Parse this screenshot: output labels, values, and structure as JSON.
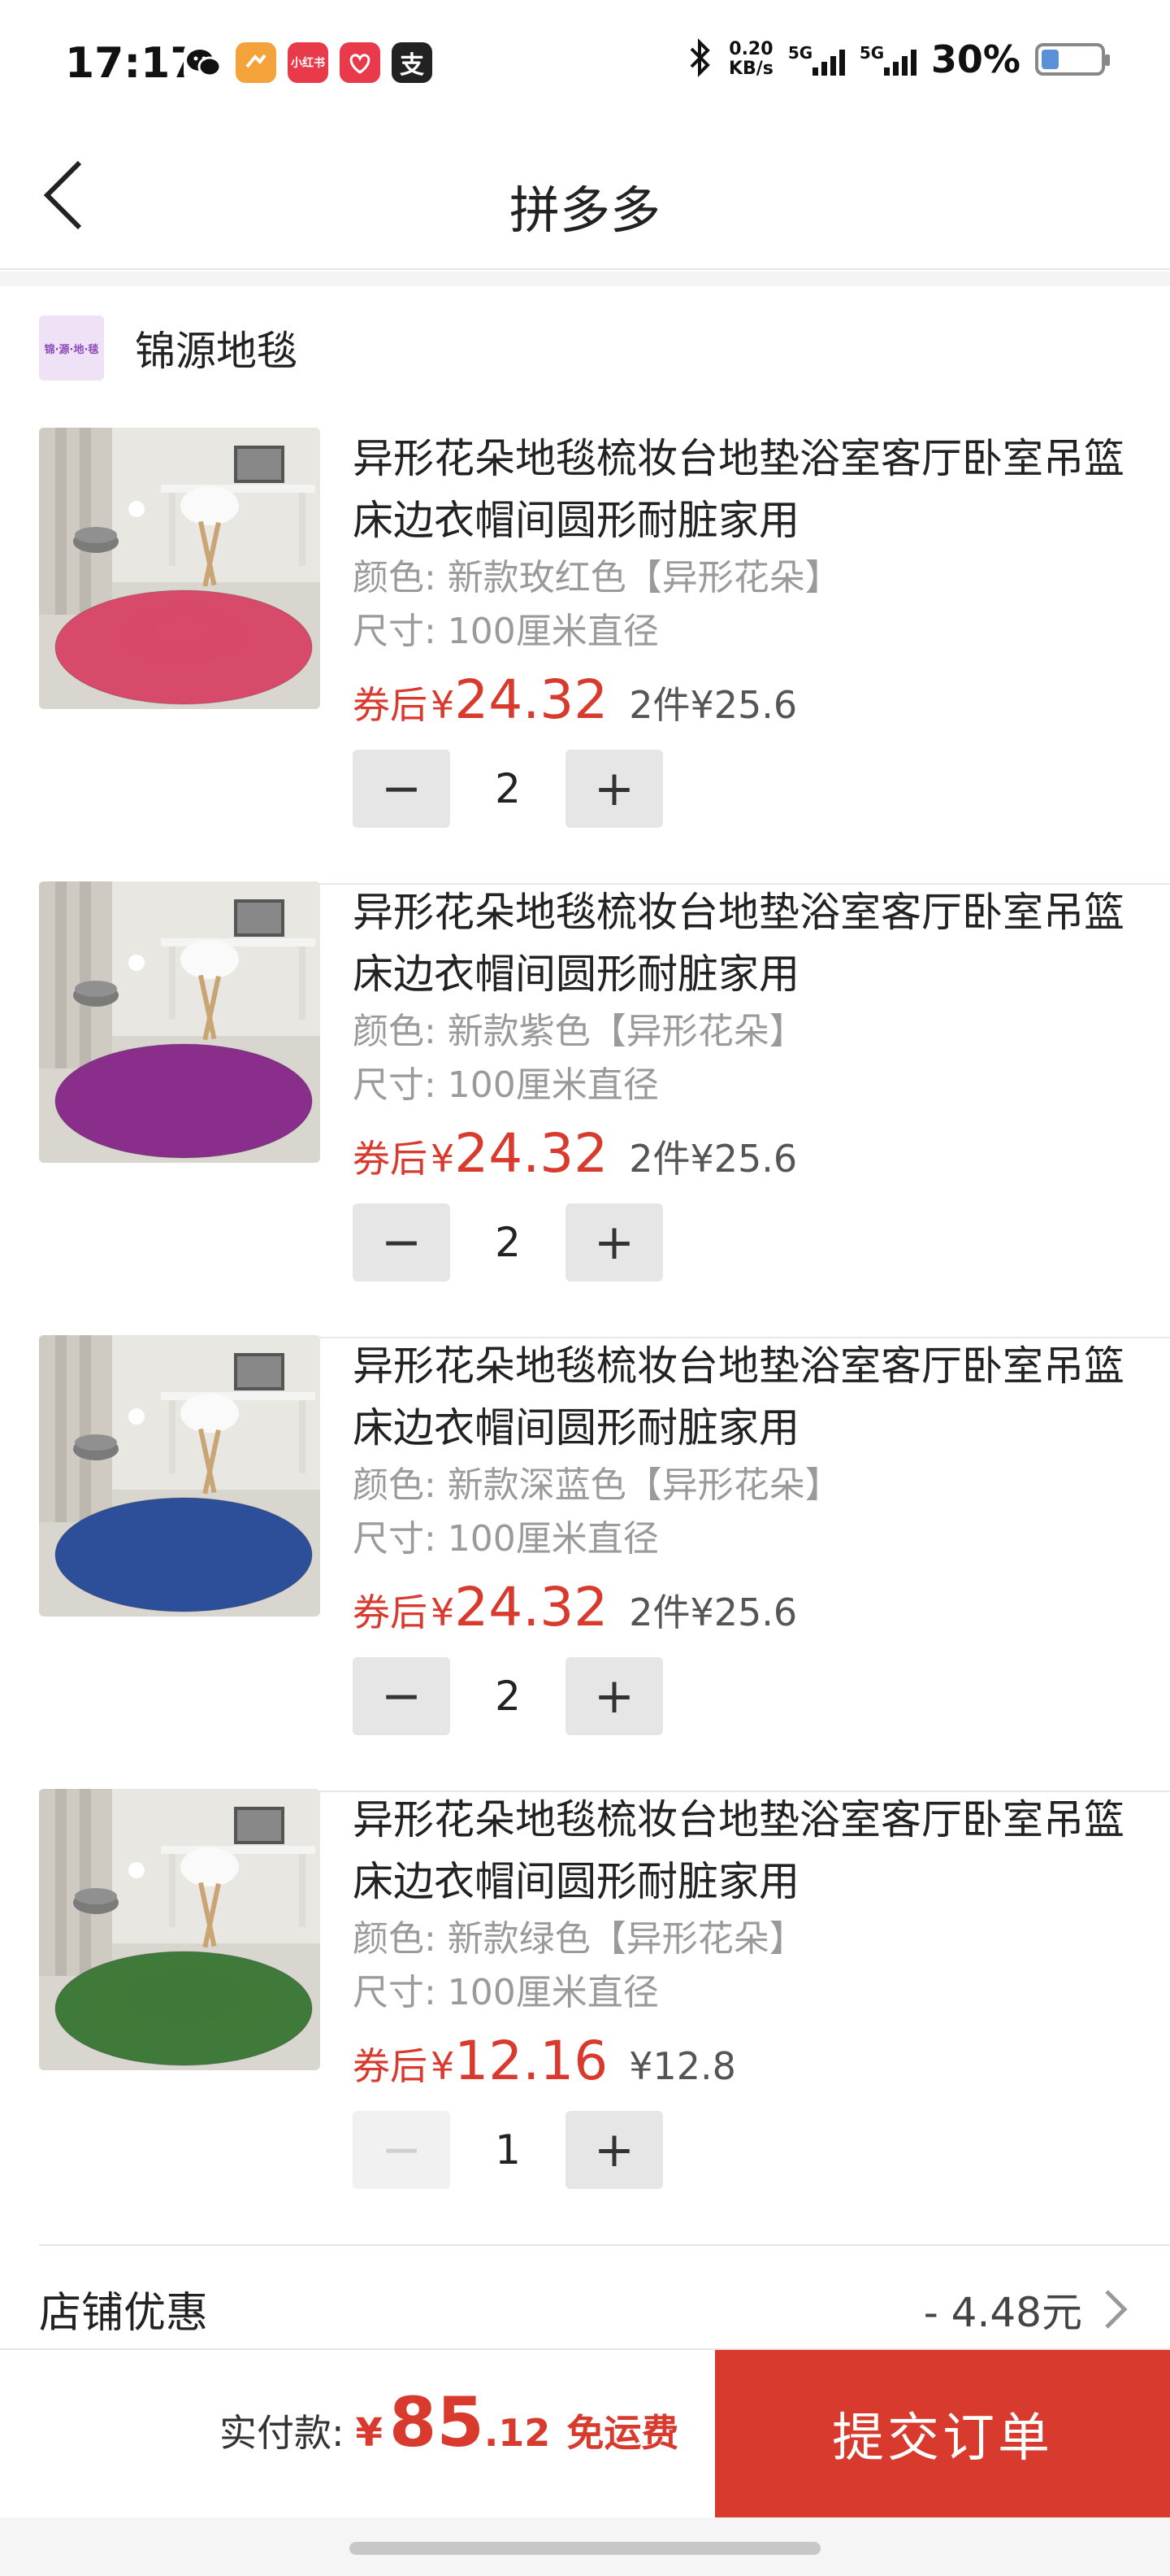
{
  "status_bar": {
    "time": "17:17",
    "apps": [
      {
        "icon": "wechat-icon",
        "label": "",
        "color": "#111111"
      },
      {
        "icon": "orange-app-icon",
        "label": "",
        "color": "#f3a33a"
      },
      {
        "icon": "xiaohongshu-icon",
        "label": "小红书",
        "color": "#e83a4a"
      },
      {
        "icon": "heart-app-icon",
        "label": "",
        "color": "#e83a4a"
      },
      {
        "icon": "alipay-icon",
        "label": "支",
        "color": "#222222"
      }
    ],
    "net_speed_value": "0.20",
    "net_speed_unit": "KB/s",
    "signal_label": "5G",
    "battery_pct": "30%",
    "battery_level": 0.3
  },
  "header": {
    "title": "拼多多"
  },
  "shop": {
    "logo_text": "锦·源·地·毯",
    "name": "锦源地毯"
  },
  "items": [
    {
      "title": "异形花朵地毯梳妆台地垫浴室客厅卧室吊篮床边衣帽间圆形耐脏家用",
      "color": "颜色: 新款玫红色【异形花朵】",
      "size": "尺寸: 100厘米直径",
      "coupon_label": "券后",
      "currency": "¥",
      "price": "24.32",
      "orig": "2件¥25.6",
      "minus": "−",
      "plus": "+",
      "qty": "2",
      "rose_color": "#d84a6a"
    },
    {
      "title": "异形花朵地毯梳妆台地垫浴室客厅卧室吊篮床边衣帽间圆形耐脏家用",
      "color": "颜色: 新款紫色【异形花朵】",
      "size": "尺寸: 100厘米直径",
      "coupon_label": "券后",
      "currency": "¥",
      "price": "24.32",
      "orig": "2件¥25.6",
      "minus": "−",
      "plus": "+",
      "qty": "2",
      "rose_color": "#8a2e8c"
    },
    {
      "title": "异形花朵地毯梳妆台地垫浴室客厅卧室吊篮床边衣帽间圆形耐脏家用",
      "color": "颜色: 新款深蓝色【异形花朵】",
      "size": "尺寸: 100厘米直径",
      "coupon_label": "券后",
      "currency": "¥",
      "price": "24.32",
      "orig": "2件¥25.6",
      "minus": "−",
      "plus": "+",
      "qty": "2",
      "rose_color": "#2d4f9a"
    },
    {
      "title": "异形花朵地毯梳妆台地垫浴室客厅卧室吊篮床边衣帽间圆形耐脏家用",
      "color": "颜色: 新款绿色【异形花朵】",
      "size": "尺寸: 100厘米直径",
      "coupon_label": "券后",
      "currency": "¥",
      "price": "12.16",
      "orig": "¥12.8",
      "minus": "−",
      "plus": "+",
      "qty": "1",
      "rose_color": "#3f7a3a"
    }
  ],
  "discount": {
    "label": "店铺优惠",
    "value": "- 4.48元"
  },
  "bottom": {
    "pay_label": "实付款:",
    "currency": "¥",
    "amount_int": "85",
    "amount_dec": ".12",
    "free_shipping": "免运费",
    "submit": "提交订单"
  },
  "colors": {
    "accent": "#d83a2e",
    "muted": "#9a9a9a"
  }
}
